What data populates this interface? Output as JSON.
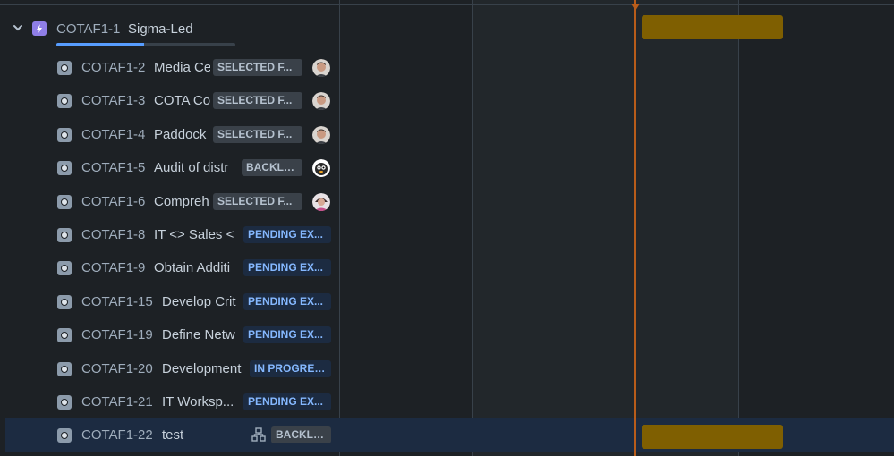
{
  "epic": {
    "key": "COTAF1-1",
    "name": "Sigma-Led",
    "progress_fraction": 0.49
  },
  "issues": [
    {
      "key": "COTAF1-2",
      "summary": "Media Ce",
      "status": "SELECTED F...",
      "status_tone": "gray",
      "avatar": "avatar-man"
    },
    {
      "key": "COTAF1-3",
      "summary": "COTA Co",
      "status": "SELECTED F...",
      "status_tone": "gray",
      "avatar": "avatar-man"
    },
    {
      "key": "COTAF1-4",
      "summary": "Paddock",
      "status": "SELECTED F...",
      "status_tone": "gray",
      "avatar": "avatar-man"
    },
    {
      "key": "COTAF1-5",
      "summary": "Audit of distr",
      "status": "BACKLOG",
      "status_tone": "gray",
      "avatar": "avatar-cartoon"
    },
    {
      "key": "COTAF1-6",
      "summary": "Compreh",
      "status": "SELECTED F...",
      "status_tone": "gray",
      "avatar": "avatar-woman"
    },
    {
      "key": "COTAF1-8",
      "summary": "IT <> Sales <",
      "status": "PENDING EX...",
      "status_tone": "blue",
      "avatar": ""
    },
    {
      "key": "COTAF1-9",
      "summary": "Obtain Additi",
      "status": "PENDING EX...",
      "status_tone": "blue",
      "avatar": ""
    },
    {
      "key": "COTAF1-15",
      "summary": "Develop Crit",
      "status": "PENDING EX...",
      "status_tone": "blue",
      "avatar": ""
    },
    {
      "key": "COTAF1-19",
      "summary": "Define Netw",
      "status": "PENDING EX...",
      "status_tone": "blue",
      "avatar": ""
    },
    {
      "key": "COTAF1-20",
      "summary": "Development",
      "status": "IN PROGRESS",
      "status_tone": "blue",
      "avatar": ""
    },
    {
      "key": "COTAF1-21",
      "summary": "IT Worksp...",
      "status": "PENDING EX...",
      "status_tone": "blue",
      "avatar": ""
    },
    {
      "key": "COTAF1-22",
      "summary": "test",
      "status": "BACKLOG",
      "status_tone": "gray",
      "avatar": "",
      "child_issues_icon": "child-issues-icon",
      "selected": true
    }
  ],
  "colors": {
    "background": "#1d2125",
    "epic_purple": "#8f7ee7",
    "progress_blue": "#579dff",
    "today_line": "#b85c1a",
    "timeline_bar": "#7f5f01",
    "lozenge_blue_text": "#85b8ff"
  }
}
